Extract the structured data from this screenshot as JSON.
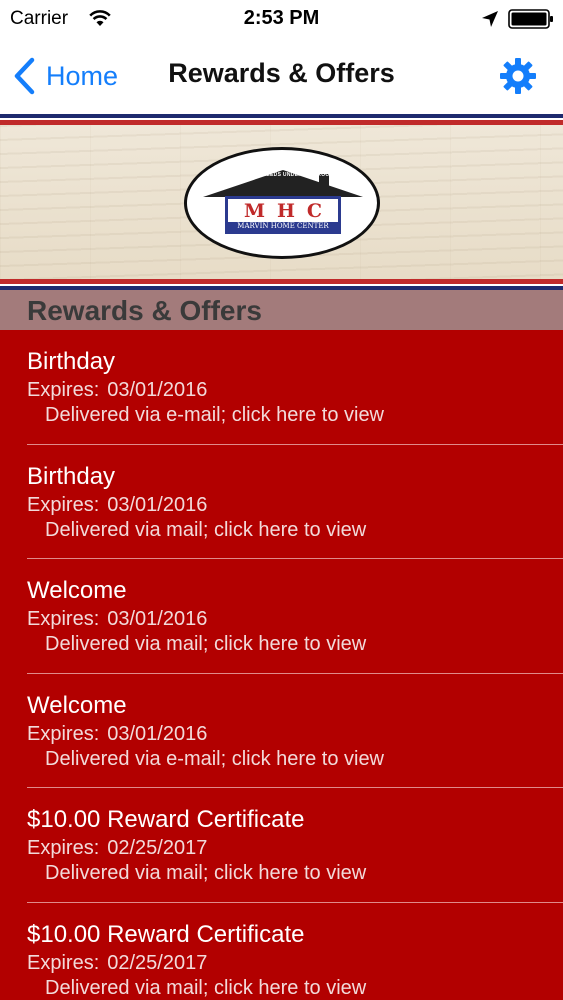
{
  "status_bar": {
    "carrier": "Carrier",
    "time": "2:53 PM"
  },
  "nav": {
    "back_label": "Home",
    "title": "Rewards & Offers",
    "accent_color": "#147efb"
  },
  "banner": {
    "logo_letters": "MHC",
    "logo_name": "MARVIN HOME CENTER",
    "logo_tagline": "ALL YOUR NEEDS UNDER ONE ROOF"
  },
  "section": {
    "title": "Rewards & Offers",
    "list_color": "#b20000"
  },
  "offers": [
    {
      "title": "Birthday",
      "expires_label": "Expires:",
      "expires": "03/01/2016",
      "delivery": "Delivered via e-mail; click here to view"
    },
    {
      "title": "Birthday",
      "expires_label": "Expires:",
      "expires": "03/01/2016",
      "delivery": "Delivered via mail; click here to view"
    },
    {
      "title": "Welcome",
      "expires_label": "Expires:",
      "expires": "03/01/2016",
      "delivery": "Delivered via mail; click here to view"
    },
    {
      "title": "Welcome",
      "expires_label": "Expires:",
      "expires": "03/01/2016",
      "delivery": "Delivered via e-mail; click here to view"
    },
    {
      "title": "$10.00 Reward Certificate",
      "expires_label": "Expires:",
      "expires": "02/25/2017",
      "delivery": "Delivered via mail; click here to view"
    },
    {
      "title": "$10.00 Reward Certificate",
      "expires_label": "Expires:",
      "expires": "02/25/2017",
      "delivery": "Delivered via mail; click here to view"
    }
  ]
}
